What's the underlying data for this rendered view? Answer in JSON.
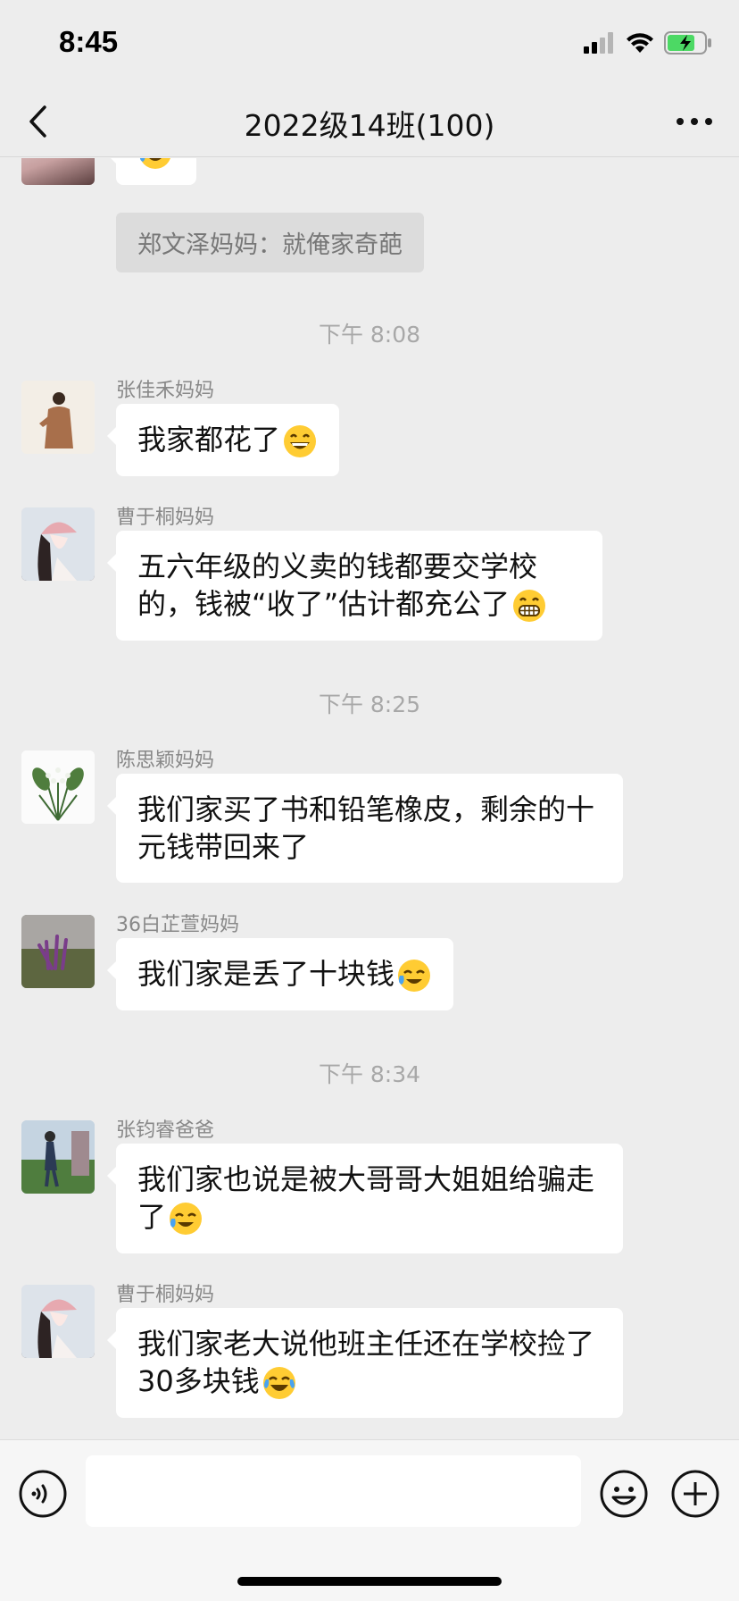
{
  "status": {
    "time": "8:45"
  },
  "nav": {
    "title": "2022级14班(100)"
  },
  "chat": {
    "system_message": "郑文泽妈妈：就俺家奇葩",
    "timestamps": [
      "下午 8:08",
      "下午 8:25",
      "下午 8:34"
    ],
    "messages": [
      {
        "sender": "张佳禾妈妈",
        "text": "我家都花了",
        "emoji": "grinning-face-icon"
      },
      {
        "sender": "曹于桐妈妈",
        "text": "五六年级的义卖的钱都要交学校的，钱被“收了”估计都充公了",
        "emoji": "grimacing-face-icon"
      },
      {
        "sender": "陈思颖妈妈",
        "text": "我们家买了书和铅笔橡皮，剩余的十元钱带回来了"
      },
      {
        "sender": "36白芷萱妈妈",
        "text": "我们家是丢了十块钱",
        "emoji": "crying-laughing-face-icon"
      },
      {
        "sender": "张钧睿爸爸",
        "text": "我们家也说是被大哥哥大姐姐给骗走了",
        "emoji": "crying-laughing-face-icon"
      },
      {
        "sender": "曹于桐妈妈",
        "text": "我们家老大说他班主任还在学校捡了30多块钱",
        "emoji": "tears-of-joy-face-icon"
      }
    ]
  },
  "input": {
    "value": ""
  },
  "colors": {
    "background": "#ededed",
    "bubble": "#ffffff",
    "battery": "#4cd964"
  }
}
